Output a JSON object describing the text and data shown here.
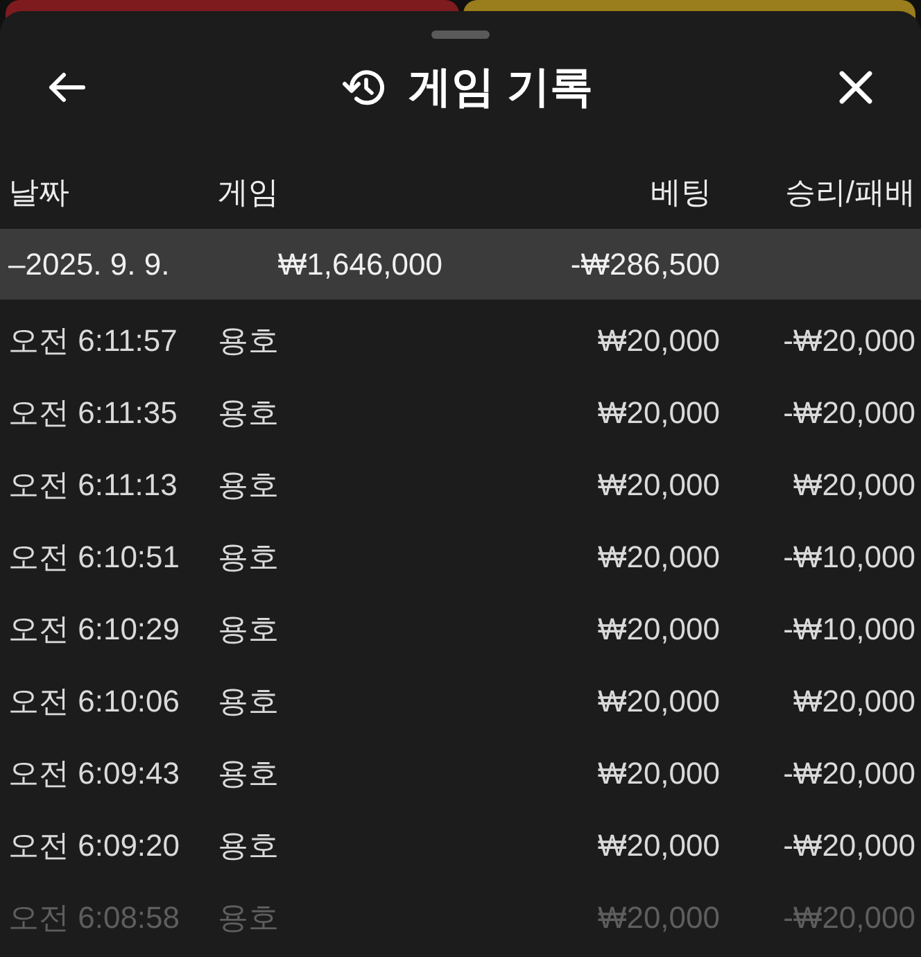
{
  "backdrop": {
    "tiles": [
      {
        "color": "#7e1b1e"
      },
      {
        "color": "#9a7d1c"
      }
    ]
  },
  "header": {
    "title": "게임 기록"
  },
  "table": {
    "columns": [
      "날짜",
      "게임",
      "베팅",
      "승리/패배"
    ],
    "summary": {
      "date": "–2025. 9. 9.",
      "bet": "₩1,646,000",
      "result": "-₩286,500"
    },
    "rows": [
      {
        "time": "오전 6:11:57",
        "game": "용호",
        "bet": "₩20,000",
        "result": "-₩20,000"
      },
      {
        "time": "오전 6:11:35",
        "game": "용호",
        "bet": "₩20,000",
        "result": "-₩20,000"
      },
      {
        "time": "오전 6:11:13",
        "game": "용호",
        "bet": "₩20,000",
        "result": "₩20,000"
      },
      {
        "time": "오전 6:10:51",
        "game": "용호",
        "bet": "₩20,000",
        "result": "-₩10,000"
      },
      {
        "time": "오전 6:10:29",
        "game": "용호",
        "bet": "₩20,000",
        "result": "-₩10,000"
      },
      {
        "time": "오전 6:10:06",
        "game": "용호",
        "bet": "₩20,000",
        "result": "₩20,000"
      },
      {
        "time": "오전 6:09:43",
        "game": "용호",
        "bet": "₩20,000",
        "result": "-₩20,000"
      },
      {
        "time": "오전 6:09:20",
        "game": "용호",
        "bet": "₩20,000",
        "result": "-₩20,000"
      },
      {
        "time": "오전 6:08:58",
        "game": "용호",
        "bet": "₩20,000",
        "result": "-₩20,000"
      }
    ]
  }
}
